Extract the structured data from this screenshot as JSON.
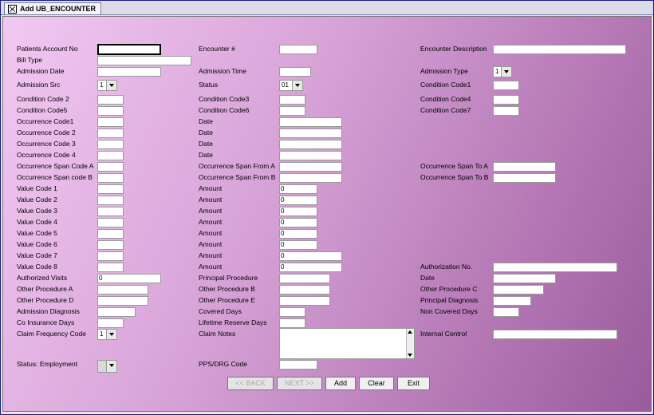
{
  "tab": {
    "title": "Add UB_ENCOUNTER"
  },
  "labels": {
    "patients_account_no": "Patients Account No",
    "encounter_no": "Encounter #",
    "encounter_description": "Encounter Description",
    "bill_type": "Bill Type",
    "admission_date": "Admission Date",
    "admission_time": "Admission Time",
    "admission_type": "Admission Type",
    "admission_src": "Admission Src",
    "status": "Status",
    "condition_code1": "Condition Code1",
    "condition_code2": "Condition Code 2",
    "condition_code3": "Condition Code3",
    "condition_code4": "Condition Code4",
    "condition_code5": "Condition Code5",
    "condition_code6": "Condition Code6",
    "condition_code7": "Condition Code7",
    "occurrence_code1": "Occurrence Code1",
    "occurrence_code2": "Occurrence Code 2",
    "occurrence_code3": "Occurrence Code 3",
    "occurrence_code4": "Occurrence Code 4",
    "date": "Date",
    "occ_span_code_a": "Occurrence Span Code A",
    "occ_span_code_b": "Occurrence Span code B",
    "occ_span_from_a": "Occurrence Span From A",
    "occ_span_from_b": "Occurrence Span From B",
    "occ_span_to_a": "Occurrence Span To A",
    "occ_span_to_b": "Occurrence Span To B",
    "value_codes": [
      "Value Code 1",
      "Value Code 2",
      "Value Code 3",
      "Value Code 4",
      "Value Code 5",
      "Value Code 6",
      "Value Code 7",
      "Value Code 8"
    ],
    "amount": "Amount",
    "authorization_no": "Authorization No.",
    "authorized_visits": "Authorized Visits",
    "principal_procedure": "Principal Procedure",
    "other_procedure_a": "Other Procedure A",
    "other_procedure_b": "Other Procedure B",
    "other_procedure_c": "Other Procedure C",
    "other_procedure_d": "Other Procedure D",
    "other_procedure_e": "Other Procedure E",
    "principal_diagnosis": "Principal Diagnosis",
    "admission_diagnosis": "Admission Diagnosis",
    "covered_days": "Covered Days",
    "non_covered_days": "Non Covered Days",
    "co_insurance_days": "Co Insurance Days",
    "lifetime_reserve_days": "Lifetime Reserve Days",
    "claim_frequency_code": "Claim Frequency Code",
    "claim_notes": "Claim Notes",
    "internal_control": "Internal Control",
    "status_employment": "Status: Employment",
    "pps_drg_code": "PPS/DRG Code"
  },
  "values": {
    "admission_type": "1",
    "admission_src": "1",
    "status": "01",
    "amounts": [
      "0",
      "0",
      "0",
      "0",
      "0",
      "0",
      "0",
      "0"
    ],
    "authorized_visits": "0",
    "claim_frequency_code": "1"
  },
  "buttons": {
    "back": "<< BACK",
    "next": "NEXT >>",
    "add": "Add",
    "clear": "Clear",
    "exit": "Exit"
  }
}
